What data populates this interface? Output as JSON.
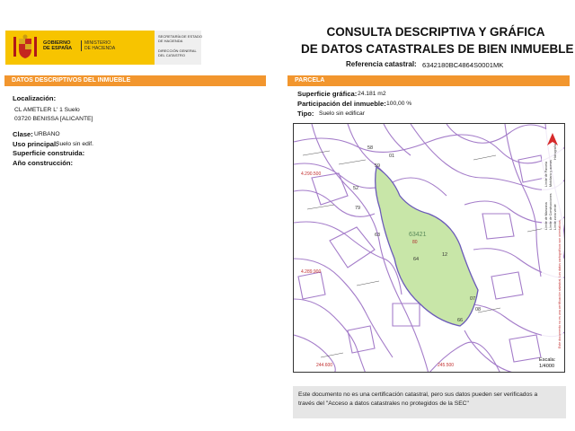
{
  "header": {
    "logo_lines": [
      "GOBIERNO",
      "DE ESPAÑA"
    ],
    "ministry_lines": [
      "MINISTERIO",
      "DE HACIENDA"
    ],
    "secretary_lines": [
      "SECRETARÍA DE ESTADO",
      "DE HACIENDA"
    ],
    "directorate_lines": [
      "DIRECCIÓN GENERAL",
      "DEL CATASTRO"
    ],
    "title_line1": "CONSULTA DESCRIPTIVA Y GRÁFICA",
    "title_line2": "DE DATOS CATASTRALES DE BIEN INMUEBLE",
    "ref_label": "Referencia catastral:",
    "ref_value": "6342180BC4864S0001MK"
  },
  "left": {
    "section_title": "DATOS DESCRIPTIVOS DEL INMUEBLE",
    "localizacion_label": "Localización:",
    "address_line1": "CL AMETLER L' 1 Suelo",
    "address_line2": "03720 BENISSA [ALICANTE]",
    "clase_label": "Clase:",
    "clase_value": "URBANO",
    "uso_label": "Uso principal:",
    "uso_value": "Suelo sin edif.",
    "superficie_label": "Superficie construida:",
    "anio_label": "Año construcción:"
  },
  "right": {
    "section_title": "PARCELA",
    "sup_label": "Superficie gráfica:",
    "sup_value": "24.181 m2",
    "part_label": "Participación del inmueble:",
    "part_value": "100,00 %",
    "tipo_label": "Tipo:",
    "tipo_value": "Suelo sin edificar"
  },
  "map": {
    "parcel_label": "63421",
    "parcel_sub": "80",
    "parcel_numbers": [
      "58",
      "59",
      "01",
      "52",
      "79",
      "63",
      "64",
      "12",
      "07",
      "08",
      "66"
    ],
    "red_coords": [
      "4.290.500",
      "4.289.900",
      "244.600",
      "245.500"
    ],
    "scale_label": "Escala:",
    "scale_value": "1/4000",
    "legend_items": [
      "Límite de Manzana",
      "Límite de Parcela",
      "Límite de Construcciones",
      "Mobiliario y aceras",
      "Límite zona verde",
      "Hidrografía"
    ],
    "side_note": "Este documento no es una certificación catastral. Los datos cartográficos son orientativos."
  },
  "notice": {
    "text_line1": "Este documento no es una certificación catastral, pero sus datos pueden ser verificados a",
    "text_line2": "través del \"Acceso a datos catastrales no protegidos de la SEC\""
  },
  "colors": {
    "orange": "#f2962e",
    "spain_yellow": "#f7c400",
    "parcel_fill": "#c8e6a8",
    "lines": "#a47cc9"
  }
}
